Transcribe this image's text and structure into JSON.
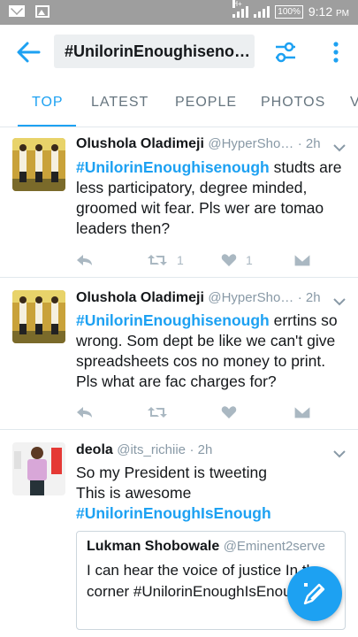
{
  "status_bar": {
    "battery": "100%",
    "time": "9:12",
    "am_pm": "PM",
    "network": "H+"
  },
  "app_bar": {
    "search_query": "#UnilorinEnoughiseno…"
  },
  "tabs": [
    {
      "label": "TOP",
      "active": true
    },
    {
      "label": "LATEST",
      "active": false
    },
    {
      "label": "PEOPLE",
      "active": false
    },
    {
      "label": "PHOTOS",
      "active": false
    },
    {
      "label": "V",
      "active": false
    }
  ],
  "tweets": [
    {
      "name": "Olushola Oladimeji",
      "handle": "@HyperSho…",
      "time": "· 2h",
      "hashtag": "#UnilorinEnoughisenough",
      "text": " studts are less participatory, degree minded, groomed wit fear. Pls wer are tomao leaders then?",
      "retweets": "1",
      "likes": "1"
    },
    {
      "name": "Olushola Oladimeji",
      "handle": "@HyperSho…",
      "time": "· 2h",
      "hashtag": "#UnilorinEnoughisenough",
      "text": " errtins so wrong. Som dept be like we can't give spreadsheets cos no money to print. Pls what are fac charges for?",
      "retweets": "",
      "likes": ""
    },
    {
      "name": "deola",
      "handle": "@its_richiie",
      "time": "· 2h",
      "line1": "So my President is tweeting",
      "line2": "This is awesome",
      "hashtag": "#UnilorinEnoughIsEnough",
      "quote": {
        "name": "Lukman Shobowale",
        "handle": "@Eminent2serve",
        "text": "I can hear the voice of justice In the corner #UnilorinEnoughIsEnough"
      }
    }
  ],
  "colors": {
    "accent": "#1da1f2",
    "status_bar": "#9e9e9e",
    "muted": "#8899a6",
    "action_icons": "#aab8c2"
  },
  "icons": [
    "mail-icon",
    "image-icon",
    "signal-icon",
    "battery-icon",
    "back-arrow-icon",
    "filter-icon",
    "more-vert-icon",
    "reply-icon",
    "retweet-icon",
    "like-icon",
    "dm-icon",
    "chevron-down-icon",
    "compose-icon"
  ]
}
